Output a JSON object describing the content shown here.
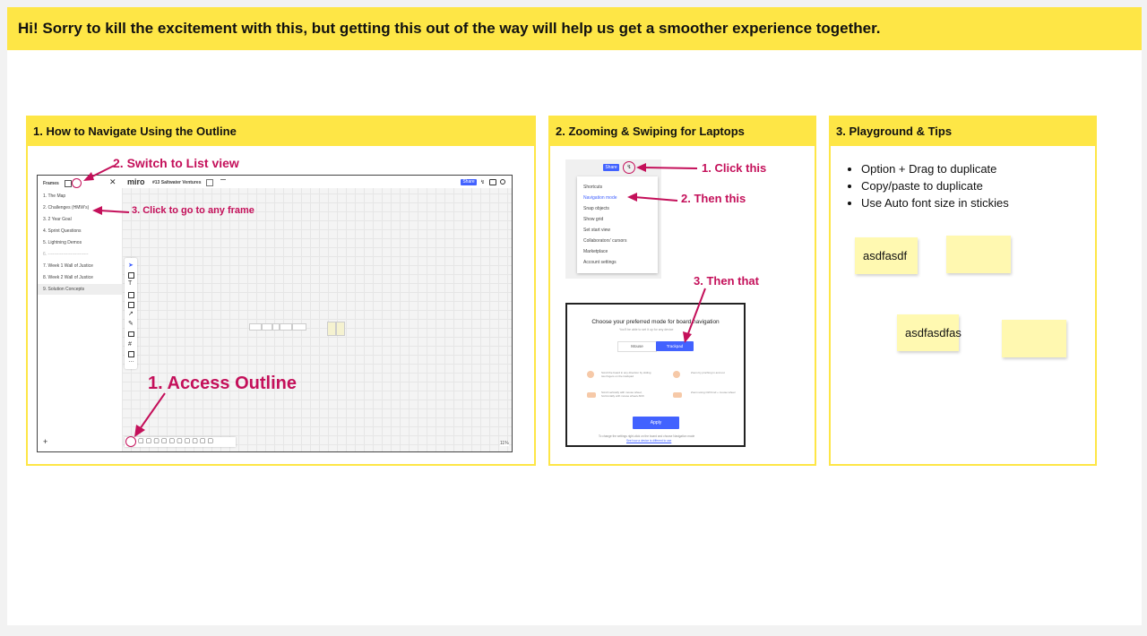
{
  "banner": {
    "text": "Hi! Sorry to kill the excitement with this, but getting this out of the way will help us get a smoother experience together."
  },
  "colors": {
    "frame_yellow": "#fee646",
    "annotation": "#c4105a",
    "sticky": "#fff9b1",
    "miro_blue": "#4262ff"
  },
  "frame1": {
    "title": "1. How to Navigate Using the Outline",
    "annotations": {
      "switch_list": "2. Switch to List view",
      "click_frame": "3. Click to go to any frame",
      "access_outline": "1. Access Outline"
    },
    "outline": {
      "title": "Frames",
      "items": [
        "1. The Map",
        "2. Challenges (HMW's)",
        "3. 2 Year Goal",
        "4. Sprint Questions",
        "5. Lightning Demos",
        "6. ---------------------------",
        "7. Week 1 Wall of Justice",
        "8. Week 2 Wall of Justice",
        "9. Solution Concepts"
      ]
    },
    "board": {
      "logo": "miro",
      "board_name": "#13 Saltwater Ventures",
      "share": "Share",
      "zoom": "11%",
      "add": "+"
    }
  },
  "frame2": {
    "title": "2. Zooming & Swiping for Laptops",
    "annotations": {
      "click_this": "1. Click this",
      "then_this": "2. Then this",
      "then_that": "3. Then that"
    },
    "menu": {
      "share": "Share",
      "items": [
        "Shortcuts",
        "Navigation mode",
        "Snap objects",
        "Show grid",
        "Set start view",
        "Collaborators' cursors",
        "Marketplace",
        "Account settings"
      ]
    },
    "dialog": {
      "title": "Choose your preferred mode for board navigation",
      "subtitle": "You'll be able to set it up for any device",
      "tab_mouse": "Mouse",
      "tab_trackpad": "Trackpad",
      "options": [
        "Scroll the board in any direction by sliding two fingers on the trackpad",
        "Zoom by pinching in and out",
        "Scroll vertically with mouse wheel, horizontally with mouse wheel+Shift",
        "Zoom using Ctrl/Cmd + mouse wheel"
      ],
      "apply": "Apply",
      "footer1": "To change the settings right-click on the board and choose Navigation mode",
      "footer2": "See how a device is different to use"
    }
  },
  "frame3": {
    "title": "3. Playground & Tips",
    "tips": [
      "Option + Drag to duplicate",
      "Copy/paste to duplicate",
      "Use Auto font size in stickies"
    ],
    "stickies": [
      "asdfasdf",
      "",
      "asdfasdfas",
      ""
    ]
  }
}
